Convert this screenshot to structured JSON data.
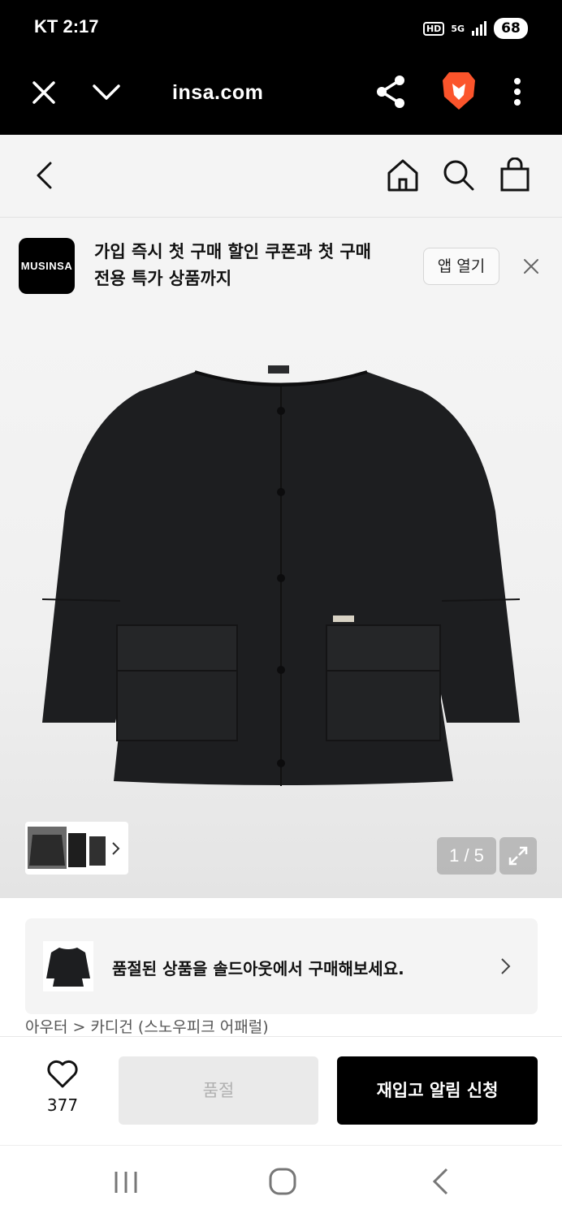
{
  "status_bar": {
    "carrier": "KT",
    "time": "2:17",
    "hd": "HD",
    "network": "5G",
    "battery": "68"
  },
  "browser": {
    "url": "insa.com"
  },
  "promo": {
    "logo_text": "MUSINSA",
    "message_line1": "가입 즉시 첫 구매 할인 쿠폰과 첫 구매",
    "message_line2": "전용 특가 상품까지",
    "open_app_label": "앱 열기"
  },
  "gallery": {
    "current_page": "1 / 5"
  },
  "soldout_banner": {
    "text": "품절된 상품을 솔드아웃에서 구매해보세요."
  },
  "breadcrumb": {
    "text": "아우터 > 카디건 (스노우피크 어패럴)"
  },
  "actions": {
    "like_count": "377",
    "soldout_label": "품절",
    "restock_label": "재입고 알림 신청"
  },
  "colors": {
    "brand": "#000000",
    "surface": "#f4f4f4"
  }
}
